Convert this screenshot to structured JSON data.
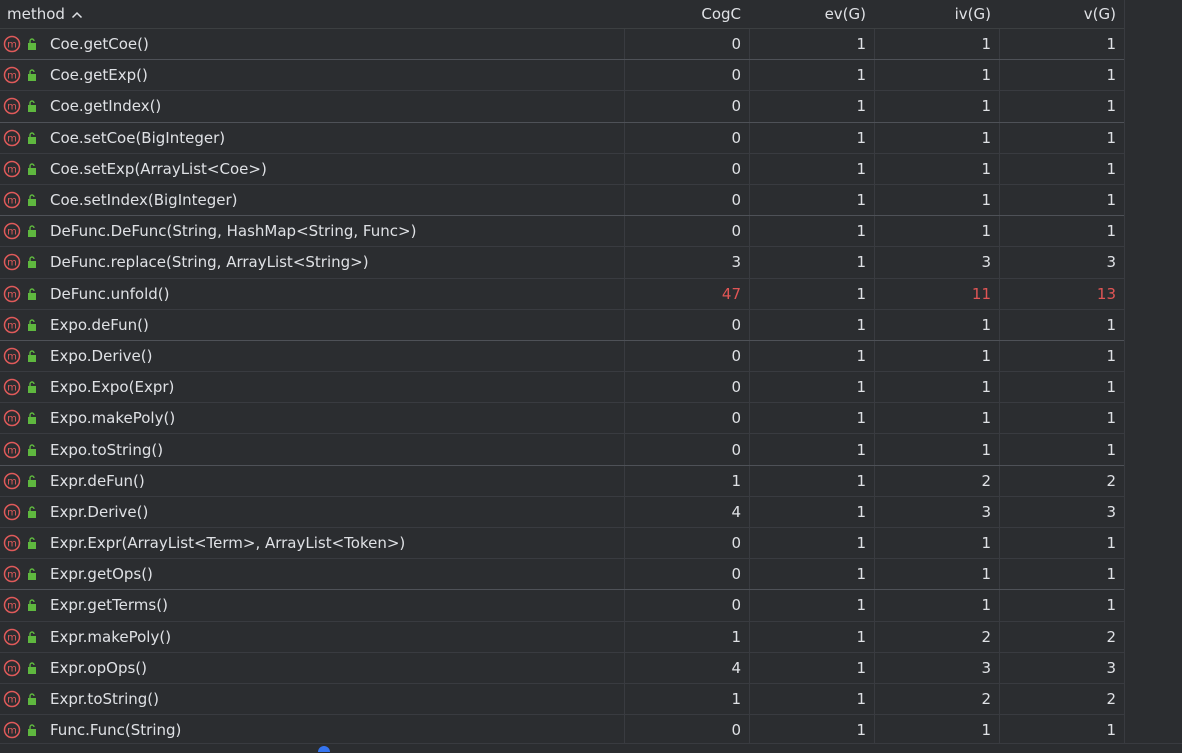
{
  "header": {
    "method": "method",
    "cogc": "CogC",
    "ev": "ev(G)",
    "iv": "iv(G)",
    "v": "v(G)"
  },
  "colors": {
    "method_icon": "#e05a5a",
    "access_icon": "#5fb83f",
    "warning": "#e05555"
  },
  "rows": [
    {
      "method": "Coe.getCoe()",
      "cogc": "0",
      "ev": "1",
      "iv": "1",
      "v": "1"
    },
    {
      "method": "Coe.getExp()",
      "cogc": "0",
      "ev": "1",
      "iv": "1",
      "v": "1"
    },
    {
      "method": "Coe.getIndex()",
      "cogc": "0",
      "ev": "1",
      "iv": "1",
      "v": "1"
    },
    {
      "method": "Coe.setCoe(BigInteger)",
      "cogc": "0",
      "ev": "1",
      "iv": "1",
      "v": "1"
    },
    {
      "method": "Coe.setExp(ArrayList<Coe>)",
      "cogc": "0",
      "ev": "1",
      "iv": "1",
      "v": "1"
    },
    {
      "method": "Coe.setIndex(BigInteger)",
      "cogc": "0",
      "ev": "1",
      "iv": "1",
      "v": "1"
    },
    {
      "method": "DeFunc.DeFunc(String, HashMap<String, Func>)",
      "cogc": "0",
      "ev": "1",
      "iv": "1",
      "v": "1"
    },
    {
      "method": "DeFunc.replace(String, ArrayList<String>)",
      "cogc": "3",
      "ev": "1",
      "iv": "3",
      "v": "3"
    },
    {
      "method": "DeFunc.unfold()",
      "cogc": "47",
      "ev": "1",
      "iv": "11",
      "v": "13"
    },
    {
      "method": "Expo.deFun()",
      "cogc": "0",
      "ev": "1",
      "iv": "1",
      "v": "1"
    },
    {
      "method": "Expo.Derive()",
      "cogc": "0",
      "ev": "1",
      "iv": "1",
      "v": "1"
    },
    {
      "method": "Expo.Expo(Expr)",
      "cogc": "0",
      "ev": "1",
      "iv": "1",
      "v": "1"
    },
    {
      "method": "Expo.makePoly()",
      "cogc": "0",
      "ev": "1",
      "iv": "1",
      "v": "1"
    },
    {
      "method": "Expo.toString()",
      "cogc": "0",
      "ev": "1",
      "iv": "1",
      "v": "1"
    },
    {
      "method": "Expr.deFun()",
      "cogc": "1",
      "ev": "1",
      "iv": "2",
      "v": "2"
    },
    {
      "method": "Expr.Derive()",
      "cogc": "4",
      "ev": "1",
      "iv": "3",
      "v": "3"
    },
    {
      "method": "Expr.Expr(ArrayList<Term>, ArrayList<Token>)",
      "cogc": "0",
      "ev": "1",
      "iv": "1",
      "v": "1"
    },
    {
      "method": "Expr.getOps()",
      "cogc": "0",
      "ev": "1",
      "iv": "1",
      "v": "1"
    },
    {
      "method": "Expr.getTerms()",
      "cogc": "0",
      "ev": "1",
      "iv": "1",
      "v": "1"
    },
    {
      "method": "Expr.makePoly()",
      "cogc": "1",
      "ev": "1",
      "iv": "2",
      "v": "2"
    },
    {
      "method": "Expr.opOps()",
      "cogc": "4",
      "ev": "1",
      "iv": "3",
      "v": "3"
    },
    {
      "method": "Expr.toString()",
      "cogc": "1",
      "ev": "1",
      "iv": "2",
      "v": "2"
    },
    {
      "method": "Func.Func(String)",
      "cogc": "0",
      "ev": "1",
      "iv": "1",
      "v": "1"
    }
  ]
}
